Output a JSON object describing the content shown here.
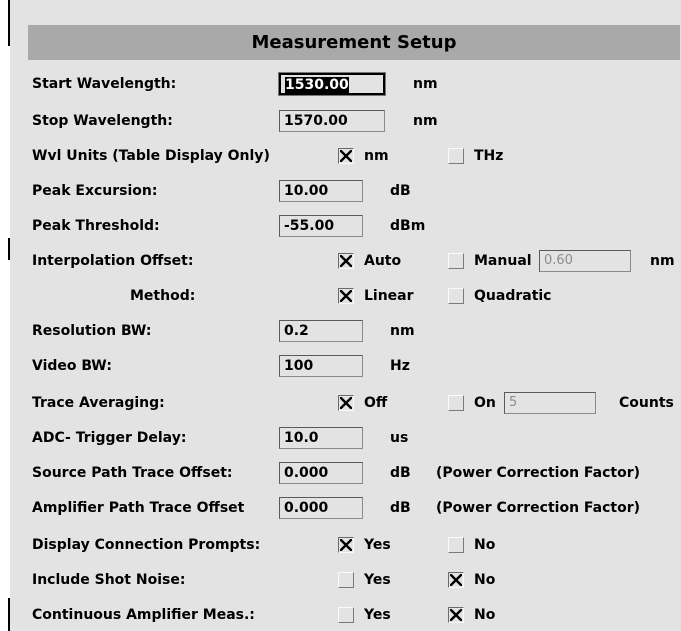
{
  "title": "Measurement Setup",
  "start_wavelength": {
    "label": "Start Wavelength:",
    "value": "1530.00",
    "unit": "nm"
  },
  "stop_wavelength": {
    "label": "Stop Wavelength:",
    "value": "1570.00",
    "unit": "nm"
  },
  "wvl_units": {
    "label": "Wvl Units (Table Display Only)",
    "opt1": "nm",
    "opt1_checked": true,
    "opt2": "THz",
    "opt2_checked": false
  },
  "peak_excursion": {
    "label": "Peak Excursion:",
    "value": "10.00",
    "unit": "dB"
  },
  "peak_threshold": {
    "label": "Peak Threshold:",
    "value": "-55.00",
    "unit": "dBm"
  },
  "interpolation_offset": {
    "label": "Interpolation Offset:",
    "opt1": "Auto",
    "opt1_checked": true,
    "opt2": "Manual",
    "opt2_checked": false,
    "manual_value": "0.60",
    "unit": "nm"
  },
  "method": {
    "label": "Method:",
    "opt1": "Linear",
    "opt1_checked": true,
    "opt2": "Quadratic",
    "opt2_checked": false
  },
  "resolution_bw": {
    "label": "Resolution BW:",
    "value": "0.2",
    "unit": "nm"
  },
  "video_bw": {
    "label": "Video BW:",
    "value": "100",
    "unit": "Hz"
  },
  "trace_averaging": {
    "label": "Trace Averaging:",
    "opt1": "Off",
    "opt1_checked": true,
    "opt2": "On",
    "opt2_checked": false,
    "count_value": "5",
    "unit": "Counts"
  },
  "adc_trigger_delay": {
    "label": "ADC- Trigger Delay:",
    "value": "10.0",
    "unit": "us"
  },
  "source_path_offset": {
    "label": "Source Path Trace Offset:",
    "value": "0.000",
    "unit": "dB",
    "note": "(Power Correction Factor)"
  },
  "amplifier_path_offset": {
    "label": "Amplifier Path Trace Offset",
    "value": "0.000",
    "unit": "dB",
    "note": "(Power Correction Factor)"
  },
  "display_connection_prompts": {
    "label": "Display Connection Prompts:",
    "opt1": "Yes",
    "opt1_checked": true,
    "opt2": "No",
    "opt2_checked": false
  },
  "include_shot_noise": {
    "label": "Include Shot Noise:",
    "opt1": "Yes",
    "opt1_checked": false,
    "opt2": "No",
    "opt2_checked": true
  },
  "continuous_amplifier": {
    "label": "Continuous Amplifier Meas.:",
    "opt1": "Yes",
    "opt1_checked": false,
    "opt2": "No",
    "opt2_checked": true
  },
  "colors": {
    "background": "#e3e3e3",
    "title_bar": "#a9a9a9",
    "disabled_text": "#8c8c8c"
  }
}
